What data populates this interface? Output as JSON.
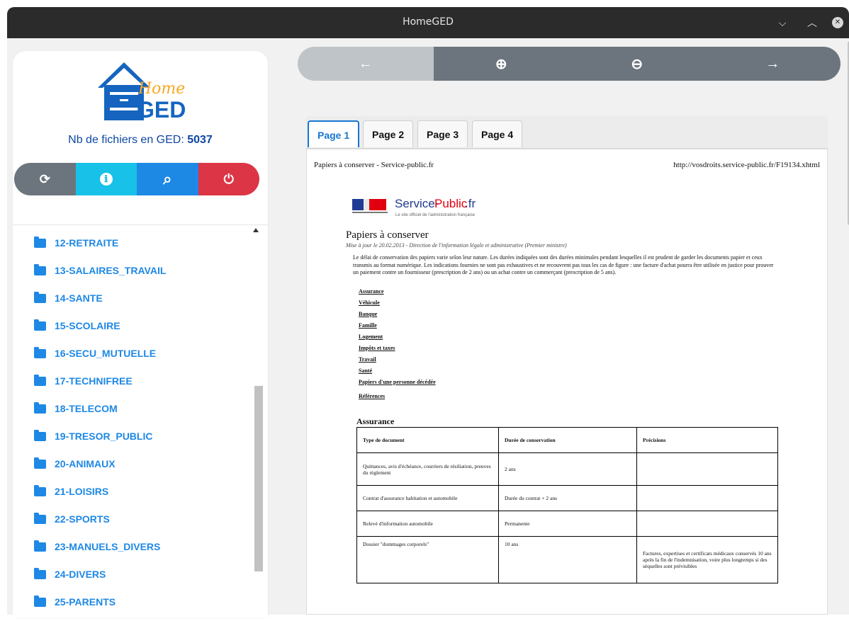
{
  "window": {
    "title": "HomeGED",
    "controls": {
      "minimize": "⌵",
      "maximize": "︿",
      "close": "✕"
    }
  },
  "sidebar": {
    "logo_home": "Home",
    "logo_ged": "GED",
    "count_label": "Nb de fichiers en GED:",
    "count_value": "5037",
    "buttons": [
      {
        "icon": "refresh-icon",
        "glyph": "⟳",
        "color": "#6c757d"
      },
      {
        "icon": "info-icon",
        "glyph": "ℹ",
        "color": "#17c1e8"
      },
      {
        "icon": "search-icon",
        "glyph": "⌕",
        "color": "#1e88e5"
      },
      {
        "icon": "power-icon",
        "glyph": "⏻",
        "color": "#dc3545"
      }
    ],
    "folders": [
      "12-RETRAITE",
      "13-SALAIRES_TRAVAIL",
      "14-SANTE",
      "15-SCOLAIRE",
      "16-SECU_MUTUELLE",
      "17-TECHNIFREE",
      "18-TELECOM",
      "19-TRESOR_PUBLIC",
      "20-ANIMAUX",
      "21-LOISIRS",
      "22-SPORTS",
      "23-MANUELS_DIVERS",
      "24-DIVERS",
      "25-PARENTS"
    ]
  },
  "toolbar": {
    "buttons": [
      {
        "name": "previous-page-button",
        "glyph": "←"
      },
      {
        "name": "zoom-in-button",
        "glyph": "⊕"
      },
      {
        "name": "zoom-out-button",
        "glyph": "⊖"
      },
      {
        "name": "next-page-button",
        "glyph": "→"
      }
    ]
  },
  "viewer": {
    "tabs": [
      "Page 1",
      "Page 2",
      "Page 3",
      "Page 4"
    ],
    "active_tab": "Page 1",
    "document": {
      "header_left": "Papiers à conserver - Service-public.fr",
      "header_right": "http://vosdroits.service-public.fr/F19134.xhtml",
      "site_name_1": "Service-",
      "site_name_2": "Public",
      "site_name_3": ".fr",
      "site_tagline": "Le site officiel de l'administration française",
      "title": "Papiers à conserver",
      "date_line": "Mise à jour le 20.02.2013 - Direction de l'information légale et administrative (Premier ministre)",
      "intro": "Le délai de conservation des papiers varie selon leur nature. Les durées indiquées sont des durées minimales pendant lesquelles il est prudent de garder les documents papier et ceux transmis au format numérique. Les indications fournies ne sont pas exhaustives et ne recouvrent pas tous les cas de figure : une facture d'achat pourra être utilisée en justice pour prouver un paiement contre un fournisseur (prescription de 2 ans) ou un achat contre un commerçant (prescription de 5 ans).",
      "links": [
        "Assurance",
        "Véhicule",
        "Banque",
        "Famille",
        "Logement",
        "Impôts et taxes",
        "Travail",
        "Santé",
        "Papiers d'une personne décédée",
        "Références"
      ],
      "section": "Assurance",
      "table_headers": [
        "Type de document",
        "Durée de conservation",
        "Précisions"
      ],
      "table_rows": [
        [
          "Quittances, avis d'échéance, courriers de résiliation, preuves du règlement",
          "2 ans",
          ""
        ],
        [
          "Contrat d'assurance habitation et automobile",
          "Durée du contrat + 2 ans",
          ""
        ],
        [
          "Relevé d'information automobile",
          "Permanente",
          ""
        ],
        [
          "Dossier \"dommages corporels\"",
          "10 ans",
          "Factures, expertises et certificats médicaux conservés 10 ans après la fin de l'indemnisation, voire plus longtemps si des séquelles sont prévisibles"
        ]
      ]
    }
  }
}
